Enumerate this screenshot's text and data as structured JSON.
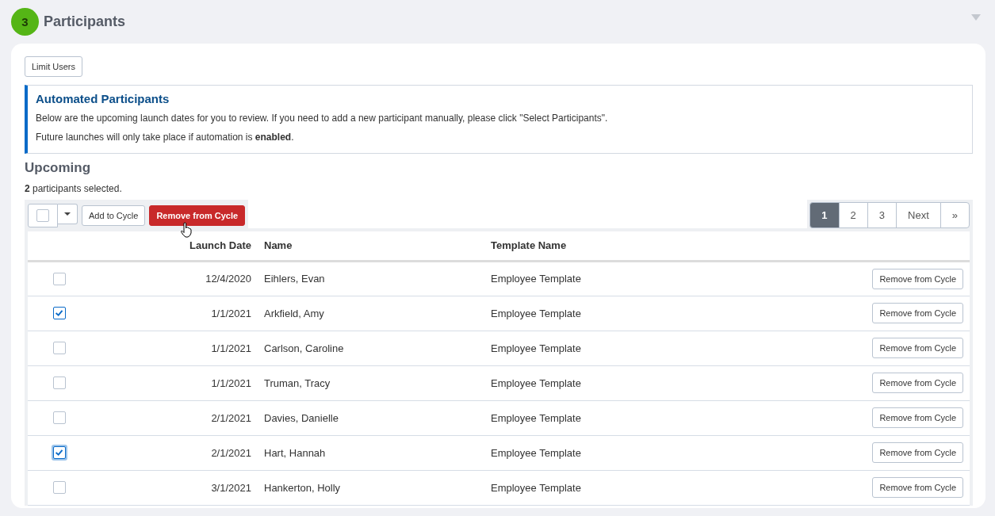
{
  "section": {
    "number": "3",
    "title": "Participants",
    "expanded": true
  },
  "limit_button": "Limit Users",
  "info": {
    "title": "Automated Participants",
    "lines": [
      "Below are the upcoming launch dates for you to review. If you need to add a new participant manually, please click \"Select Participants\".",
      "Future launches will only take place if automation is **enabled**."
    ]
  },
  "upcoming": {
    "title": "Upcoming",
    "selected_count": "**2** participants selected.",
    "select_all_checked": false,
    "add_button": "Add to Cycle",
    "remove_button": "Remove from Cycle"
  },
  "pagination": [
    {
      "label": "1",
      "selected": true
    },
    {
      "label": "2",
      "selected": false
    },
    {
      "label": "3",
      "selected": false
    },
    {
      "label": "Next",
      "selected": false
    },
    {
      "label": "»",
      "selected": false
    }
  ],
  "table": {
    "columns": [
      "Launch Date",
      "Name",
      "Template Name"
    ],
    "rows": [
      {
        "checked": false,
        "focused": false,
        "date": "12/4/2020",
        "name": "Eihlers, Evan",
        "template": "Employee Template",
        "action": "Remove from Cycle"
      },
      {
        "checked": true,
        "focused": false,
        "date": "1/1/2021",
        "name": "Arkfield, Amy",
        "template": "Employee Template",
        "action": "Remove from Cycle"
      },
      {
        "checked": false,
        "focused": false,
        "date": "1/1/2021",
        "name": "Carlson, Caroline",
        "template": "Employee Template",
        "action": "Remove from Cycle"
      },
      {
        "checked": false,
        "focused": false,
        "date": "1/1/2021",
        "name": "Truman, Tracy",
        "template": "Employee Template",
        "action": "Remove from Cycle"
      },
      {
        "checked": false,
        "focused": false,
        "date": "2/1/2021",
        "name": "Davies, Danielle",
        "template": "Employee Template",
        "action": "Remove from Cycle"
      },
      {
        "checked": true,
        "focused": true,
        "date": "2/1/2021",
        "name": "Hart, Hannah",
        "template": "Employee Template",
        "action": "Remove from Cycle"
      },
      {
        "checked": false,
        "focused": false,
        "date": "3/1/2021",
        "name": "Hankerton, Holly",
        "template": "Employee Template",
        "action": "Remove from Cycle"
      }
    ]
  }
}
